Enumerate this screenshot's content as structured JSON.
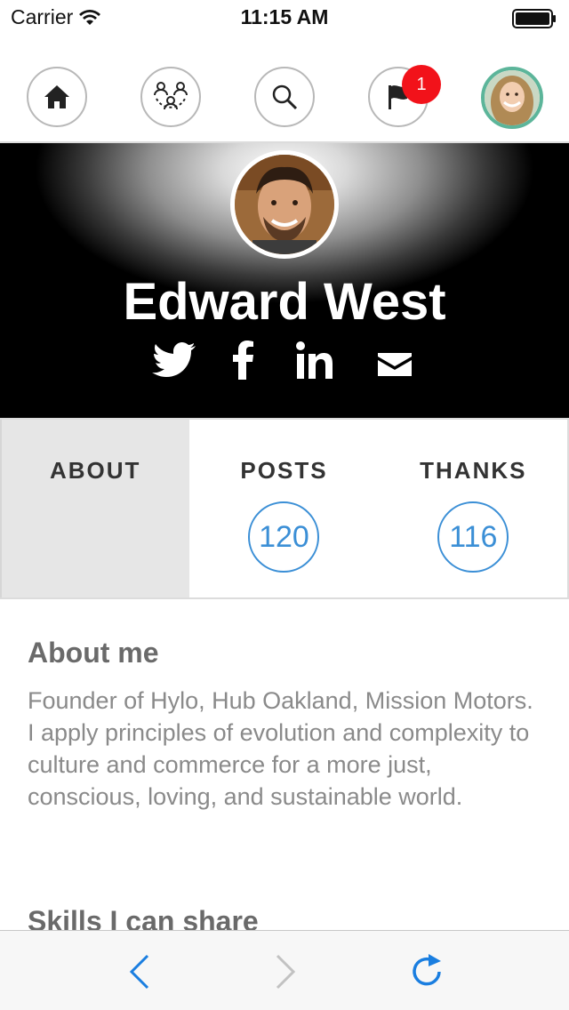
{
  "status_bar": {
    "carrier": "Carrier",
    "time": "11:15 AM"
  },
  "nav": {
    "items": [
      {
        "icon": "home-icon"
      },
      {
        "icon": "community-icon"
      },
      {
        "icon": "search-icon"
      },
      {
        "icon": "flag-icon",
        "badge": "1"
      },
      {
        "icon": "user-avatar"
      }
    ]
  },
  "profile": {
    "name": "Edward West",
    "socials": [
      "twitter-icon",
      "facebook-icon",
      "linkedin-icon",
      "email-icon"
    ]
  },
  "tabs": [
    {
      "label": "ABOUT",
      "active": true
    },
    {
      "label": "POSTS",
      "count": "120"
    },
    {
      "label": "THANKS",
      "count": "116"
    }
  ],
  "about": {
    "title": "About me",
    "text": "Founder of Hylo, Hub Oakland, Mission Motors. I apply principles of evolution and complexity to culture and commerce for a more just, conscious, loving, and sustainable world."
  },
  "skills": {
    "title": "Skills I can share"
  },
  "colors": {
    "accent": "#3b8fd6",
    "badge": "#f2121a",
    "avatar_ring": "#5cb59a"
  }
}
